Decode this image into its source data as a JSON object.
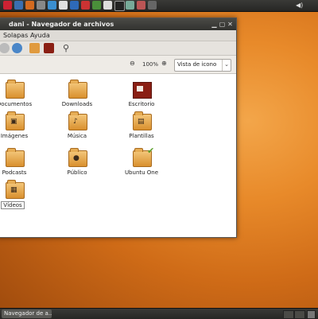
{
  "window": {
    "title": "dani - Navegador de archivos",
    "close_glyph": "✕"
  },
  "menu": [
    "Solapas",
    "Ayuda"
  ],
  "zoom": {
    "out_glyph": "🔍",
    "value": "100%",
    "in_glyph": "🔍"
  },
  "view_select": {
    "selected": "Vista de icono",
    "arrow": "⌄"
  },
  "items": [
    {
      "label": "Documentos",
      "kind": "folder",
      "badge": ""
    },
    {
      "label": "Downloads",
      "kind": "folder",
      "badge": ""
    },
    {
      "label": "Escritorio",
      "kind": "desktop",
      "badge": ""
    },
    {
      "label": "Imágenes",
      "kind": "folder",
      "badge": "▣"
    },
    {
      "label": "Música",
      "kind": "folder",
      "badge": "♪"
    },
    {
      "label": "Plantillas",
      "kind": "folder",
      "badge": "▤"
    },
    {
      "label": "Podcasts",
      "kind": "folder",
      "badge": ""
    },
    {
      "label": "Público",
      "kind": "folder",
      "badge": "●"
    },
    {
      "label": "Ubuntu One",
      "kind": "folder",
      "badge": "",
      "sync": "✔"
    },
    {
      "label": "Vídeos",
      "kind": "folder",
      "badge": "▦"
    }
  ],
  "taskbar": {
    "task_label": "Navegador de a..."
  },
  "tray": {
    "volume_glyph": "◀)"
  },
  "colors": {
    "desktop_orange": "#e88a2a",
    "panel_dark": "#2f2f2d",
    "folder": "#e6ad55"
  }
}
